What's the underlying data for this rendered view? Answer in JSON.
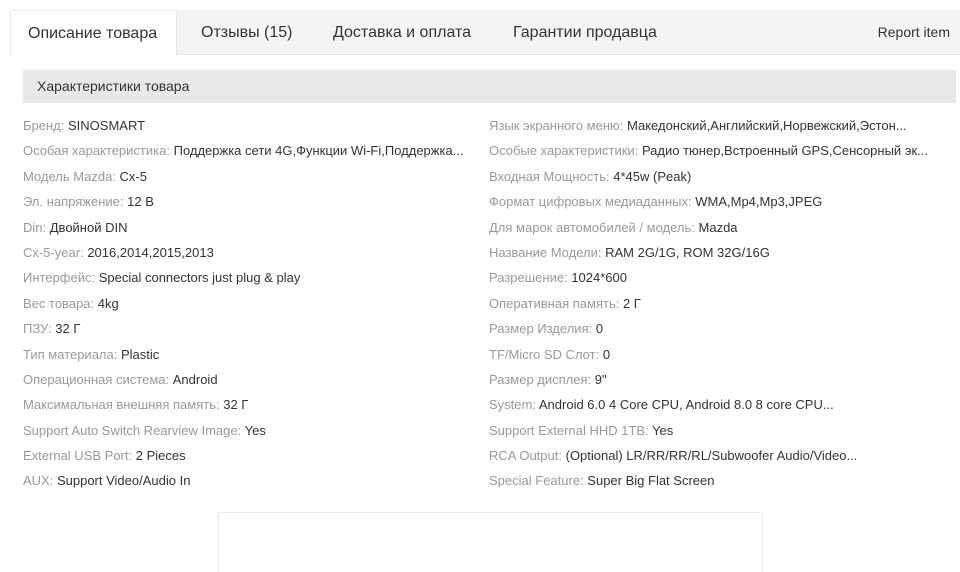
{
  "tabs": [
    {
      "label": "Описание товара"
    },
    {
      "label": "Отзывы (15)"
    },
    {
      "label": "Доставка и оплата"
    },
    {
      "label": "Гарантии продавца"
    }
  ],
  "report_label": "Report item",
  "spec_title": "Характеристики товара",
  "specs_left": [
    {
      "key": "Бренд:",
      "value": "SINOSMART"
    },
    {
      "key": "Особая характеристика:",
      "value": "Поддержка сети 4G,Функции Wi-Fi,Поддержка..."
    },
    {
      "key": "Модель Mazda:",
      "value": "Cx-5"
    },
    {
      "key": "Эл. напряжение:",
      "value": "12 В"
    },
    {
      "key": "Din:",
      "value": "Двойной DIN"
    },
    {
      "key": "Cx-5-year:",
      "value": "2016,2014,2015,2013"
    },
    {
      "key": "Интерфейс:",
      "value": "Special connectors just plug & play"
    },
    {
      "key": "Вес товара:",
      "value": "4kg"
    },
    {
      "key": "ПЗУ:",
      "value": "32 Г"
    },
    {
      "key": "Тип материала:",
      "value": "Plastic"
    },
    {
      "key": "Операционная система:",
      "value": "Android"
    },
    {
      "key": "Максимальная внешняя память:",
      "value": "32 Г"
    },
    {
      "key": "Support Auto Switch Rearview Image:",
      "value": "Yes"
    },
    {
      "key": "External USB Port:",
      "value": "2 Pieces"
    },
    {
      "key": "AUX:",
      "value": "Support Video/Audio In"
    }
  ],
  "specs_right": [
    {
      "key": "Язык экранного меню:",
      "value": "Македонский,Английский,Норвежский,Эстон..."
    },
    {
      "key": "Особые характеристики:",
      "value": "Радио тюнер,Встроенный GPS,Сенсорный эк..."
    },
    {
      "key": "Входная Мощность:",
      "value": "4*45w (Peak)"
    },
    {
      "key": "Формат цифровых медиаданных:",
      "value": "WMA,Mp4,Mp3,JPEG"
    },
    {
      "key": "Для марок автомобилей / модель:",
      "value": "Mazda"
    },
    {
      "key": "Название Модели:",
      "value": "RAM 2G/1G, ROM 32G/16G"
    },
    {
      "key": "Разрешение:",
      "value": "1024*600"
    },
    {
      "key": "Оперативная память:",
      "value": "2 Г"
    },
    {
      "key": "Размер Изделия:",
      "value": "0"
    },
    {
      "key": "TF/Micro SD Слот:",
      "value": "0"
    },
    {
      "key": "Размер дисплея:",
      "value": "9\""
    },
    {
      "key": "System:",
      "value": "Android 6.0 4 Core CPU, Android 8.0 8 core CPU..."
    },
    {
      "key": "Support External HHD 1TB:",
      "value": "Yes"
    },
    {
      "key": "RCA Output:",
      "value": "(Optional) LR/RR/RR/RL/Subwoofer Audio/Video..."
    },
    {
      "key": "Special Feature:",
      "value": "Super Big Flat Screen"
    }
  ]
}
